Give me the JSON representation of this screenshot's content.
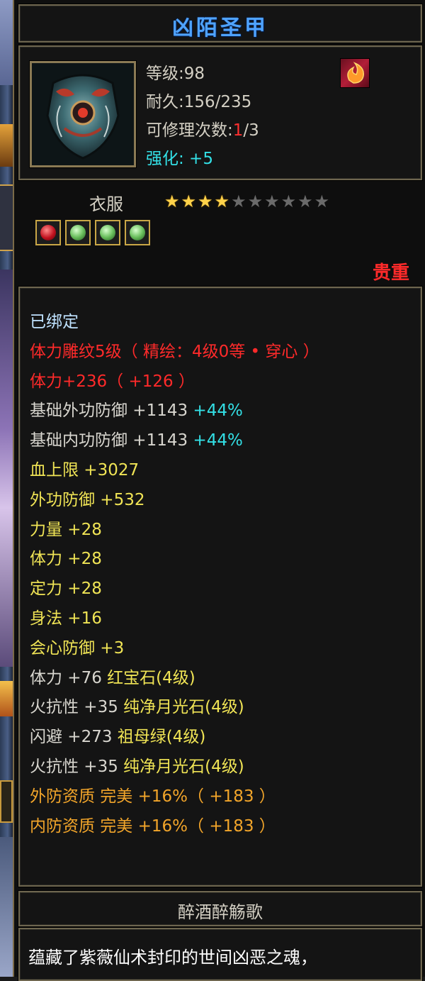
{
  "item": {
    "name": "凶陌圣甲",
    "icon": "armor-chestplate-icon",
    "skill_icon": "flame-swirl-icon",
    "level_label": "等级",
    "level_value": ":98",
    "durability_label": "耐久",
    "durability_value": ":156/235",
    "repair_label": "可修理次数",
    "repair_sep": ":",
    "repair_used": "1",
    "repair_total": "/3",
    "strengthen_label": "强化",
    "strengthen_value": ": +5",
    "category": "衣服",
    "stars_filled": 4,
    "stars_total": 10,
    "gems": [
      "red-gem-icon",
      "green-gem-icon",
      "green-gem-icon",
      "green-gem-icon"
    ],
    "rarity": "贵重"
  },
  "attributes": [
    {
      "text": "已绑定",
      "color": "lightblue"
    },
    {
      "text": "体力雕纹5级（ 精绘：4级0等 • 穿心 ）",
      "color": "red"
    },
    {
      "text": "体力+236（ +126 ）",
      "color": "red"
    },
    {
      "text": "基础外功防御 +1143 ",
      "extra": "+44%",
      "color": "white"
    },
    {
      "text": "基础内功防御 +1143 ",
      "extra": "+44%",
      "color": "white"
    },
    {
      "text": "血上限 +3027",
      "color": "yellow"
    },
    {
      "text": "外功防御 +532",
      "color": "yellow"
    },
    {
      "text": "力量 +28",
      "color": "yellow"
    },
    {
      "text": "体力 +28",
      "color": "yellow"
    },
    {
      "text": "定力 +28",
      "color": "yellow"
    },
    {
      "text": "身法 +16",
      "color": "yellow"
    },
    {
      "text": "会心防御 +3",
      "color": "yellow"
    },
    {
      "text": "体力 +76 红宝石(4级)",
      "color": "white_yellow",
      "split": "体力 +76 ",
      "rest": "红宝石(4级)"
    },
    {
      "text": "火抗性 +35 纯净月光石(4级)",
      "color": "white_yellow",
      "split": "火抗性 +35 ",
      "rest": "纯净月光石(4级)"
    },
    {
      "text": "闪避 +273 祖母绿(4级)",
      "color": "white_yellow",
      "split": "闪避 +273 ",
      "rest": "祖母绿(4级)"
    },
    {
      "text": "火抗性 +35 纯净月光石(4级)",
      "color": "white_yellow",
      "split": "火抗性 +35 ",
      "rest": "纯净月光石(4级)"
    },
    {
      "text": "外防资质   完美 +16%（ +183 ）",
      "color": "orange"
    },
    {
      "text": "内防资质   完美 +16%（ +183 ）",
      "color": "orange"
    }
  ],
  "set_name": "醉酒醉觞歌",
  "description": "蕴藏了紫薇仙术封印的世间凶恶之魂，",
  "colors": {
    "title": "#4fa3ff",
    "red": "#ff2a2a",
    "cyan": "#33e0e6",
    "yellow": "#f0e455",
    "orange": "#f2a52a",
    "lightblue": "#bfe2ff"
  }
}
